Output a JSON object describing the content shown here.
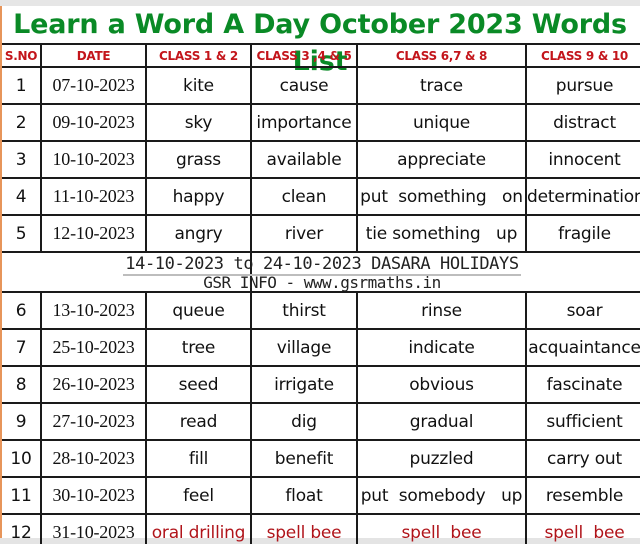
{
  "title": "Learn a Word A Day October 2023 Words List",
  "colors": {
    "title_green": "#0a8a26",
    "header_red": "#c3151b",
    "activity_red": "#b0141a",
    "left_strip_orange": "#e7955a"
  },
  "table": {
    "headers": [
      "S.NO",
      "DATE",
      "CLASS 1 & 2",
      "CLASS 3 ,4 & 5",
      "CLASS 6,7 & 8",
      "CLASS 9 & 10"
    ],
    "rows_before_holiday": [
      {
        "sno": "1",
        "date": "07-10-2023",
        "class_1_2": "kite",
        "class_3_4_5": "cause",
        "class_6_7_8": "trace",
        "class_9_10": "pursue"
      },
      {
        "sno": "2",
        "date": "09-10-2023",
        "class_1_2": "sky",
        "class_3_4_5": "importance",
        "class_6_7_8": "unique",
        "class_9_10": "distract"
      },
      {
        "sno": "3",
        "date": "10-10-2023",
        "class_1_2": "grass",
        "class_3_4_5": "available",
        "class_6_7_8": "appreciate",
        "class_9_10": "innocent"
      },
      {
        "sno": "4",
        "date": "11-10-2023",
        "class_1_2": "happy",
        "class_3_4_5": "clean",
        "class_6_7_8": "put  something   on",
        "class_9_10": "determination"
      },
      {
        "sno": "5",
        "date": "12-10-2023",
        "class_1_2": "angry",
        "class_3_4_5": "river",
        "class_6_7_8": "tie something   up",
        "class_9_10": "fragile"
      }
    ],
    "holiday": {
      "line1": "14-10-2023 to 24-10-2023 DASARA HOLIDAYS",
      "line2": "GSR INFO - www.gsrmaths.in"
    },
    "rows_after_holiday": [
      {
        "sno": "6",
        "date": "13-10-2023",
        "class_1_2": "queue",
        "class_3_4_5": "thirst",
        "class_6_7_8": "rinse",
        "class_9_10": "soar"
      },
      {
        "sno": "7",
        "date": "25-10-2023",
        "class_1_2": "tree",
        "class_3_4_5": "village",
        "class_6_7_8": "indicate",
        "class_9_10": "acquaintance"
      },
      {
        "sno": "8",
        "date": "26-10-2023",
        "class_1_2": "seed",
        "class_3_4_5": "irrigate",
        "class_6_7_8": "obvious",
        "class_9_10": "fascinate"
      },
      {
        "sno": "9",
        "date": "27-10-2023",
        "class_1_2": "read",
        "class_3_4_5": "dig",
        "class_6_7_8": "gradual",
        "class_9_10": "sufficient"
      },
      {
        "sno": "10",
        "date": "28-10-2023",
        "class_1_2": "fill",
        "class_3_4_5": "benefit",
        "class_6_7_8": "puzzled",
        "class_9_10": "carry out"
      },
      {
        "sno": "11",
        "date": "30-10-2023",
        "class_1_2": "feel",
        "class_3_4_5": "float",
        "class_6_7_8": "put  somebody   up",
        "class_9_10": "resemble"
      },
      {
        "sno": "12",
        "date": "31-10-2023",
        "class_1_2": "oral drilling",
        "class_3_4_5": "spell bee",
        "class_6_7_8": "spell  bee",
        "class_9_10": "spell  bee",
        "activity": true
      }
    ]
  }
}
